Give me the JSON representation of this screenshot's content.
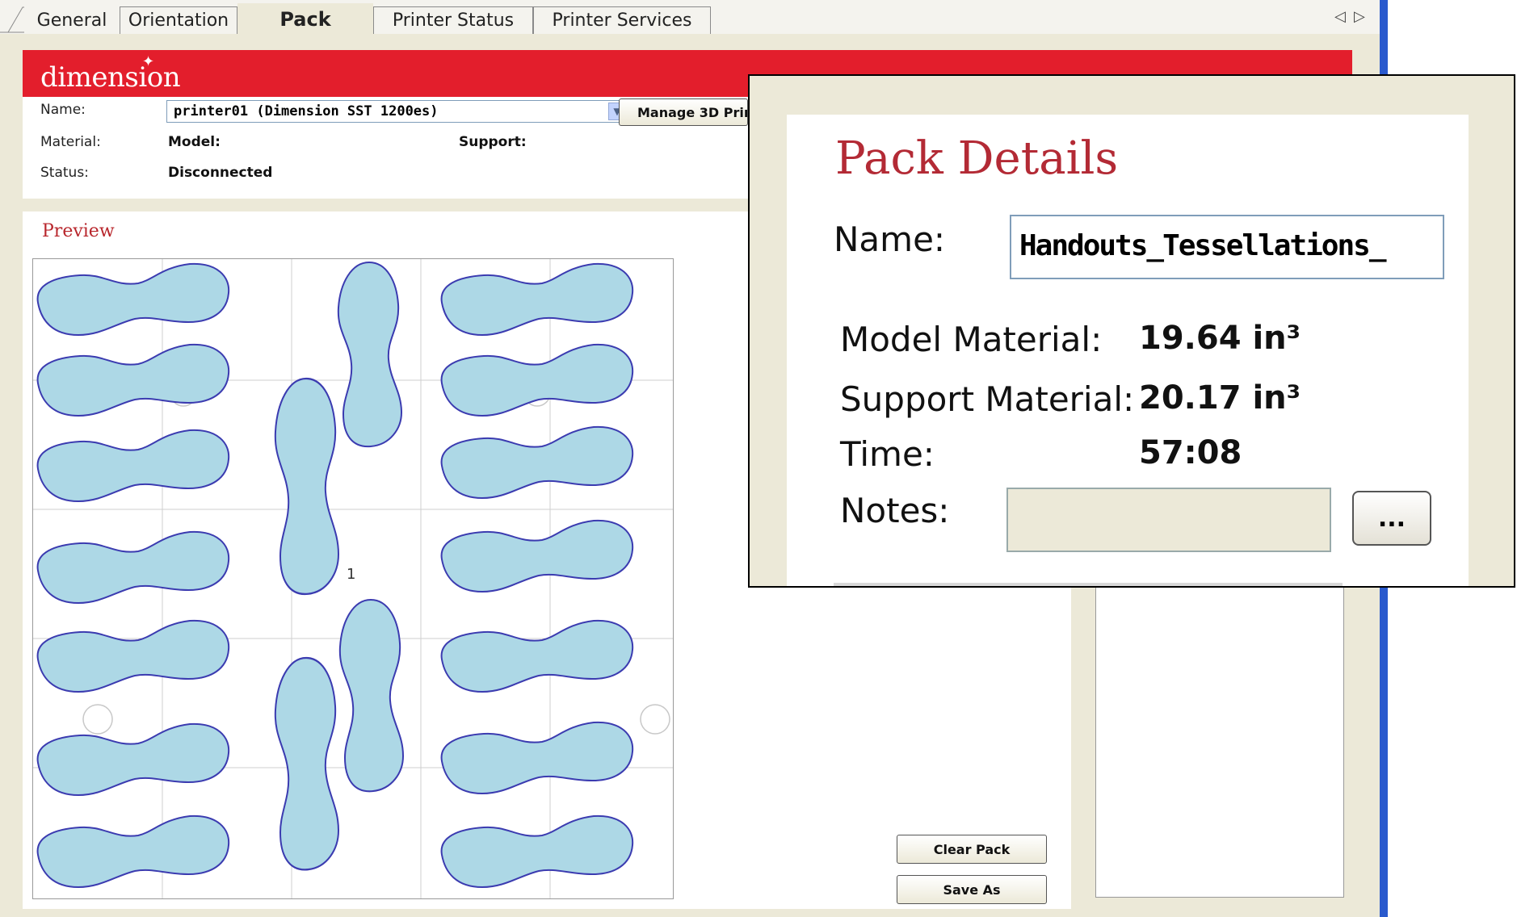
{
  "tabs": {
    "general": "General",
    "orientation": "Orientation",
    "pack": "Pack",
    "printer_status": "Printer Status",
    "printer_services": "Printer Services"
  },
  "header": {
    "logo": "dimension",
    "name_label": "Name:",
    "name_value": "printer01  (Dimension SST 1200es)",
    "manage_button": "Manage 3D Prin",
    "material_label": "Material:",
    "model_label": "Model:",
    "support_label": "Support:",
    "status_label": "Status:",
    "status_value": "Disconnected"
  },
  "preview": {
    "title": "Preview",
    "part_label": "1"
  },
  "buttons": {
    "clear_pack": "Clear Pack",
    "save_as": "Save As"
  },
  "pack_details": {
    "title": "Pack Details",
    "name_label": "Name:",
    "name_value": "Handouts_Tessellations_",
    "model_material_label": "Model Material:",
    "model_material_value": "19.64 in³",
    "support_material_label": "Support Material:",
    "support_material_value": "20.17 in³",
    "time_label": "Time:",
    "time_value": "57:08",
    "notes_label": "Notes:",
    "notes_button": "..."
  },
  "colors": {
    "brand_red": "#e31e2c",
    "part_fill": "#add8e6",
    "part_outline": "#3b3bb0",
    "accent_blue": "#2a5acd"
  }
}
